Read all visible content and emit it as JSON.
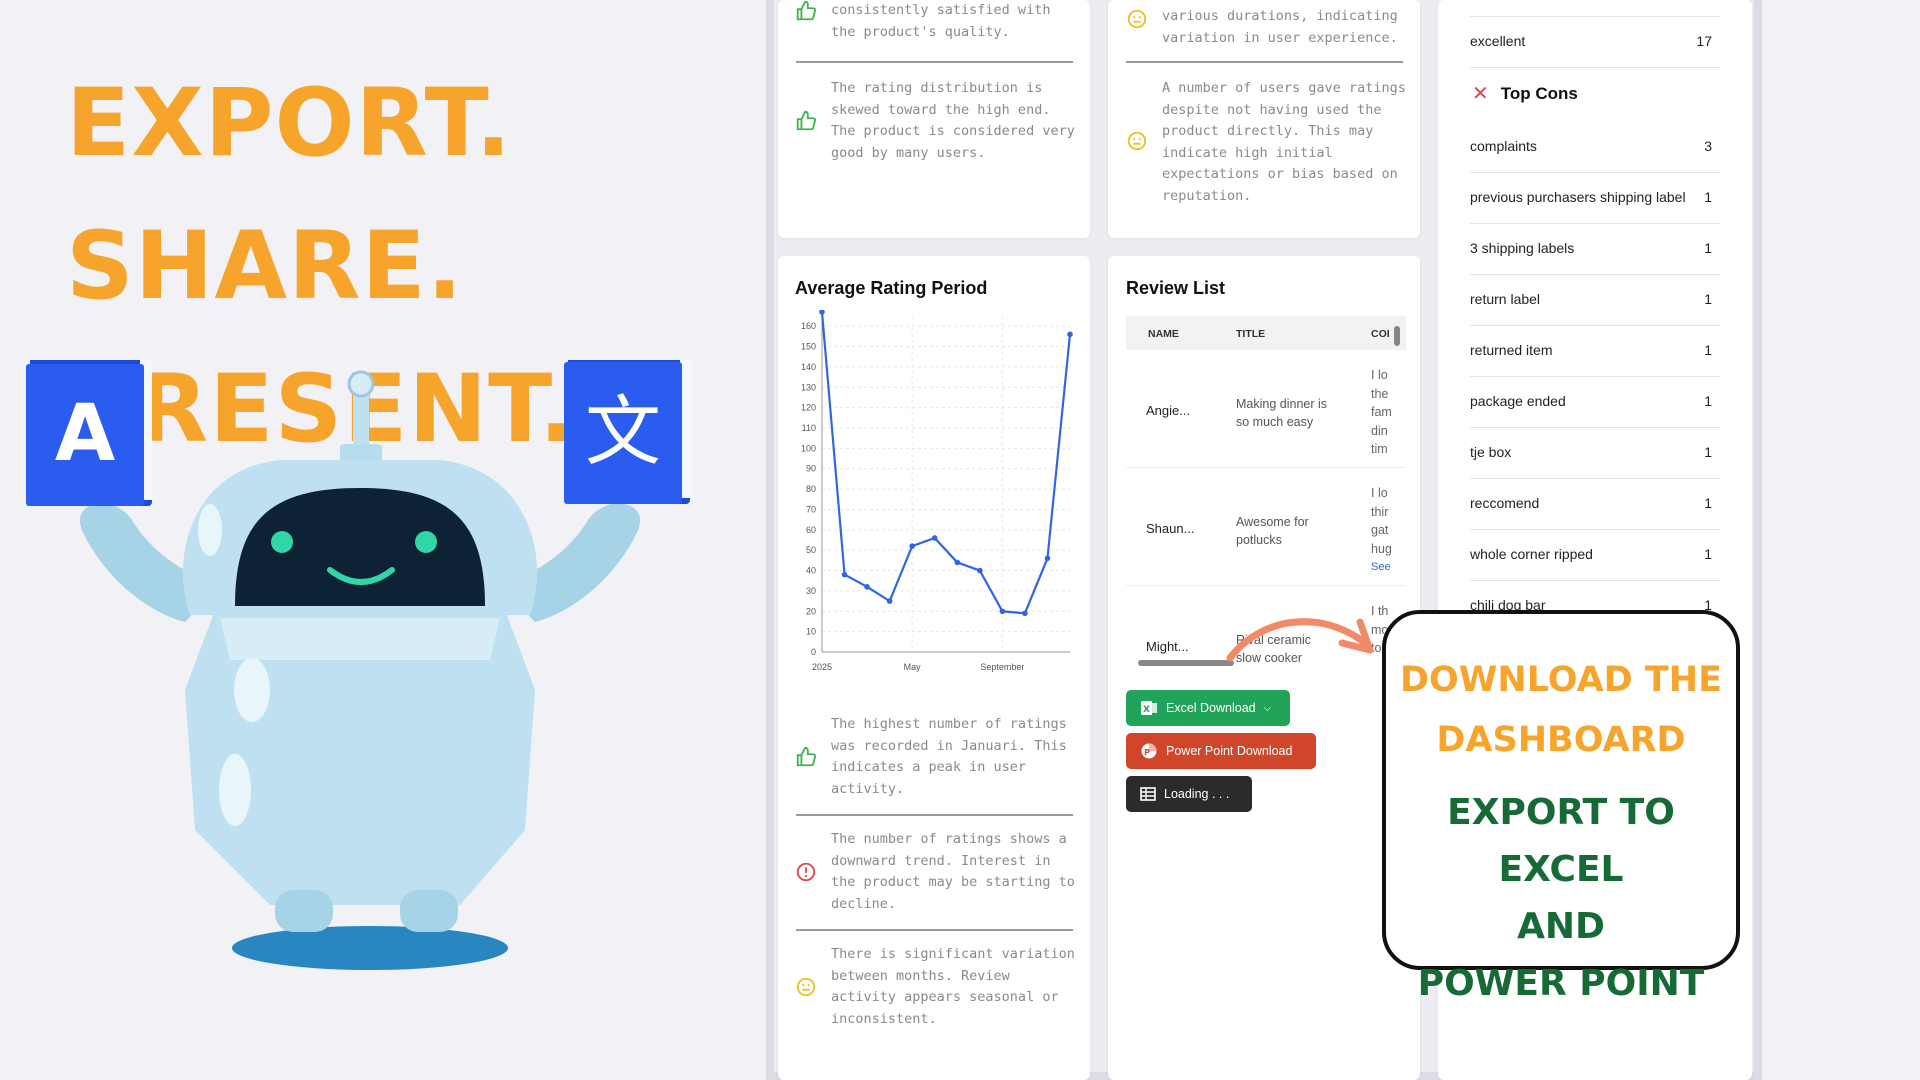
{
  "headline": {
    "line1": "EXPORT. SHARE.",
    "line2": "PRESENT."
  },
  "robot": {
    "book_left_letter": "A",
    "book_right_letter": "文"
  },
  "insights_top_left": [
    {
      "icon": "thumbs-up-icon",
      "text": "consistently satisfied with the product's quality."
    },
    {
      "icon": "thumbs-up-icon",
      "text": "The rating distribution is skewed toward the high end. The product is considered very good by many users."
    }
  ],
  "insights_top_right": [
    {
      "icon": "neutral-face-icon",
      "text": "various durations, indicating variation in user experience."
    },
    {
      "icon": "neutral-face-icon",
      "text": "A number of users gave ratings despite not having used the product directly. This may indicate high initial expectations or bias based on reputation."
    }
  ],
  "avg_rating_card": {
    "title": "Average Rating Period"
  },
  "chart_data": {
    "type": "line",
    "title": "Average Rating Period",
    "xlabel": "",
    "ylabel": "",
    "x_tick_labels": [
      "2025",
      "May",
      "September"
    ],
    "y_ticks": [
      0,
      10,
      20,
      30,
      40,
      50,
      60,
      70,
      80,
      90,
      100,
      110,
      120,
      130,
      140,
      150,
      160
    ],
    "ylim": [
      0,
      165
    ],
    "grid": true,
    "series": [
      {
        "values": [
          167,
          38,
          32,
          25,
          52,
          56,
          44,
          40,
          20,
          19,
          46,
          156
        ]
      }
    ],
    "color": "#3366dd"
  },
  "insights_bottom": [
    {
      "icon": "thumbs-up-icon",
      "text": "The highest number of ratings was recorded in Januari. This indicates a peak in user activity."
    },
    {
      "icon": "alert-circle-icon",
      "text": "The number of ratings shows a downward trend. Interest in the product may be starting to decline."
    },
    {
      "icon": "neutral-face-icon",
      "text": "There is significant variation between months. Review activity appears seasonal or inconsistent."
    }
  ],
  "review_list": {
    "title": "Review List",
    "columns": [
      "NAME",
      "TITLE",
      "COI"
    ],
    "rows": [
      {
        "name": "Angie...",
        "title": "Making dinner is so much easy",
        "comment": [
          "I lo",
          "the",
          "fam",
          "din",
          "tim"
        ]
      },
      {
        "name": "Shaun...",
        "title": "Awesome for potlucks",
        "comment": [
          "I lo",
          "thir",
          "gat",
          "hug"
        ],
        "see": "See"
      },
      {
        "name": "Might...",
        "title": "Rival ceramic slow cooker",
        "comment": [
          "I th",
          "mo",
          "to"
        ]
      }
    ]
  },
  "buttons": {
    "excel": "Excel Download",
    "ppt": "Power Point Download",
    "loading": "Loading . . ."
  },
  "pros_tail": {
    "label": "excellent",
    "count": "17"
  },
  "cons": {
    "title": "Top Cons",
    "items": [
      {
        "label": "complaints",
        "count": "3"
      },
      {
        "label": "previous purchasers shipping label",
        "count": "1"
      },
      {
        "label": "3 shipping labels",
        "count": "1"
      },
      {
        "label": "return label",
        "count": "1"
      },
      {
        "label": "returned item",
        "count": "1"
      },
      {
        "label": "package ended",
        "count": "1"
      },
      {
        "label": "tje box",
        "count": "1"
      },
      {
        "label": "reccomend",
        "count": "1"
      },
      {
        "label": "whole corner ripped",
        "count": "1"
      },
      {
        "label": "chili dog bar",
        "count": "1"
      }
    ]
  },
  "callout": {
    "line1": "DOWNLOAD THE",
    "line2": "DASHBOARD",
    "line3": "EXPORT TO EXCEL",
    "line4": "AND",
    "line5": "POWER POINT"
  },
  "colors": {
    "accent_orange": "#f7a42d",
    "accent_green": "#166a36",
    "excel_green": "#22a35a",
    "ppt_red": "#d0462a",
    "line_blue": "#3366dd"
  }
}
